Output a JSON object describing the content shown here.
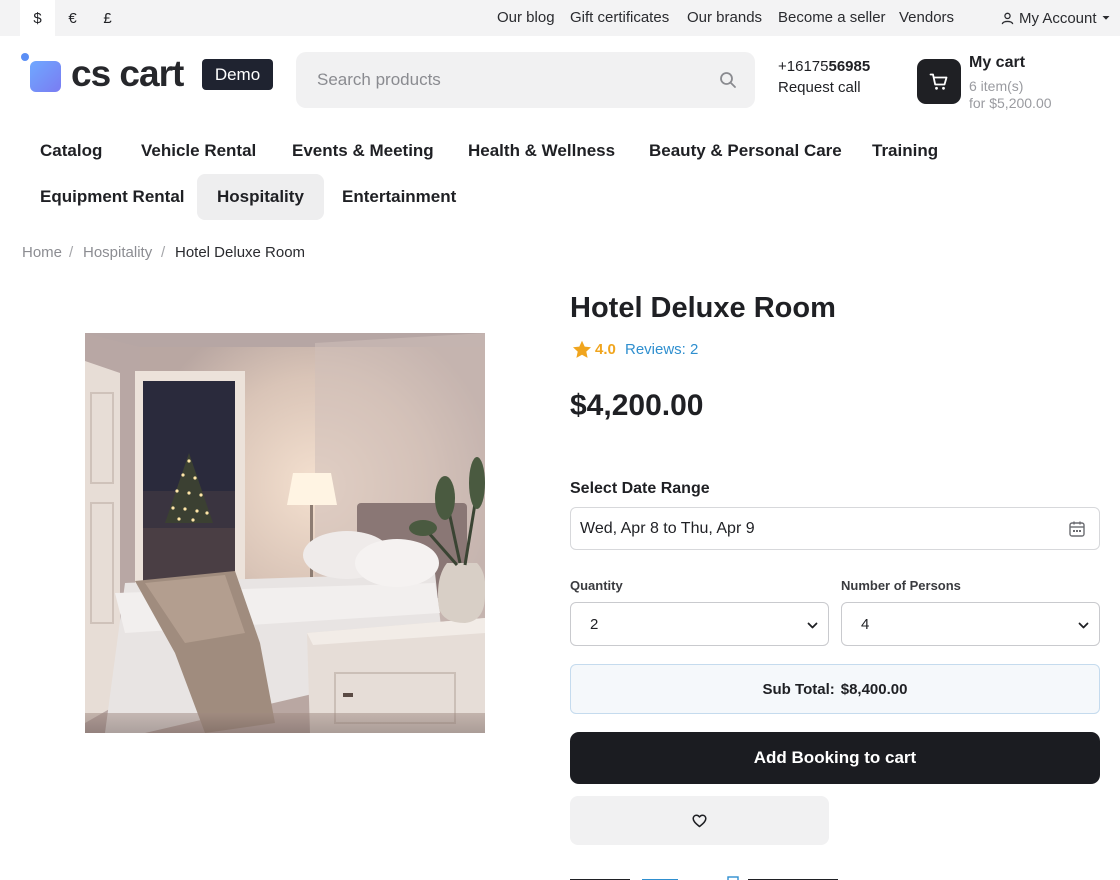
{
  "topbar": {
    "currencies": [
      {
        "symbol": "$",
        "active": true
      },
      {
        "symbol": "€",
        "active": false
      },
      {
        "symbol": "£",
        "active": false
      }
    ],
    "links": [
      "Our blog",
      "Gift certificates",
      "Our brands",
      "Become a seller",
      "Vendors"
    ],
    "account_label": "My Account"
  },
  "header": {
    "logo_text": "cs cart",
    "demo_badge": "Demo",
    "search_placeholder": "Search products",
    "phone_prefix": "+16175",
    "phone_bold": "56985",
    "request_call": "Request call",
    "cart": {
      "title": "My cart",
      "count": "6 item(s)",
      "total": "for $5,200.00"
    }
  },
  "nav": {
    "items": [
      "Catalog",
      "Vehicle Rental",
      "Events & Meeting",
      "Health & Wellness",
      "Beauty & Personal Care",
      "Training",
      "Equipment Rental",
      "Hospitality",
      "Entertainment"
    ],
    "active": "Hospitality"
  },
  "breadcrumb": {
    "items": [
      "Home",
      "Hospitality",
      "Hotel Deluxe Room"
    ],
    "separator": "/"
  },
  "product": {
    "title": "Hotel Deluxe Room",
    "rating": "4.0",
    "reviews": "Reviews: 2",
    "price": "$4,200.00",
    "date_label": "Select Date Range",
    "date_value": "Wed, Apr 8 to Thu, Apr 9",
    "quantity_label": "Quantity",
    "quantity_value": "2",
    "persons_label": "Number of Persons",
    "persons_value": "4",
    "subtotal_label": "Sub Total:",
    "subtotal_value": "$8,400.00",
    "add_button": "Add Booking to cart"
  },
  "colors": {
    "accent_dark": "#1b1c21",
    "link_blue": "#2f8fcf",
    "star": "#f0a51e",
    "logo_gradient_start": "#6fa8ff",
    "logo_gradient_end": "#7a7cf2"
  }
}
